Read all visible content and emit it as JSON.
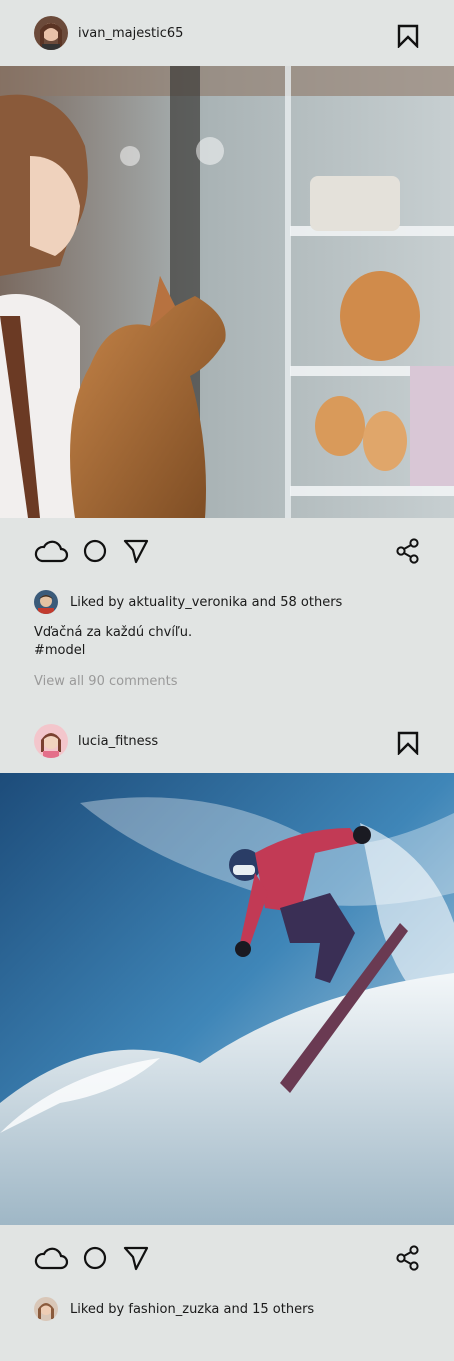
{
  "posts": [
    {
      "username": "ivan_majestic65",
      "liked_by_user": "aktuality_veronika",
      "liked_text": "Liked by aktuality_veronika and 58 others",
      "caption": "Vďačná za každú chvíľu.",
      "hashtag": "#model",
      "comments_link": "View all 90 comments",
      "image_description_icon": "photo-girl-cat-shop-window"
    },
    {
      "username": "lucia_fitness",
      "liked_by_user": "fashion_zuzka",
      "liked_text": "Liked by fashion_zuzka and 15 others",
      "image_description_icon": "photo-snowboarder"
    }
  ],
  "icons": {
    "like": "cloud-icon",
    "comment": "circle-icon",
    "send": "send-arrow-icon",
    "share": "share-icon",
    "save": "bookmark-icon"
  },
  "colors": {
    "background": "#e1e4e3",
    "text": "#1a1a1a",
    "muted": "#9a9a9a"
  }
}
